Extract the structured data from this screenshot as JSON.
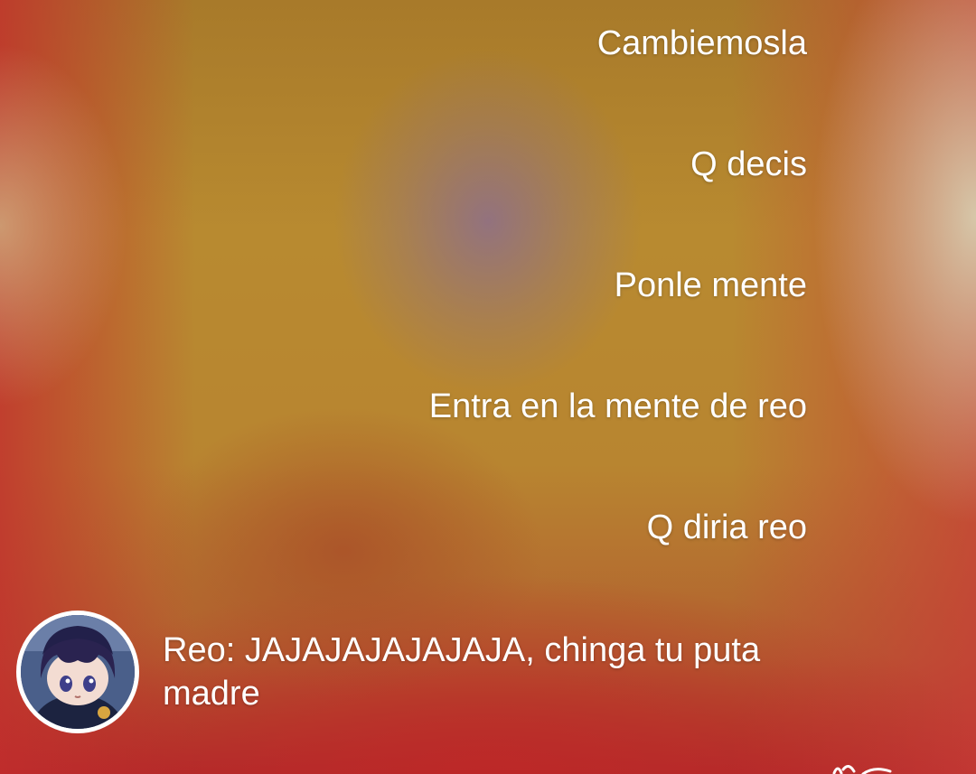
{
  "messages": {
    "outgoing": [
      "Cambiemosla",
      "Q decis",
      "Ponle mente",
      "Entra en la mente de reo",
      "Q diria reo"
    ],
    "incoming": {
      "sender": "Reo:",
      "text": "JAJAJAJAJAJAJA, chinga tu puta madre",
      "avatar_icon": "anime-character-avatar"
    }
  },
  "colors": {
    "text": "#ffffff",
    "background_main": "#b7862c",
    "background_edge": "#b02a2a"
  }
}
